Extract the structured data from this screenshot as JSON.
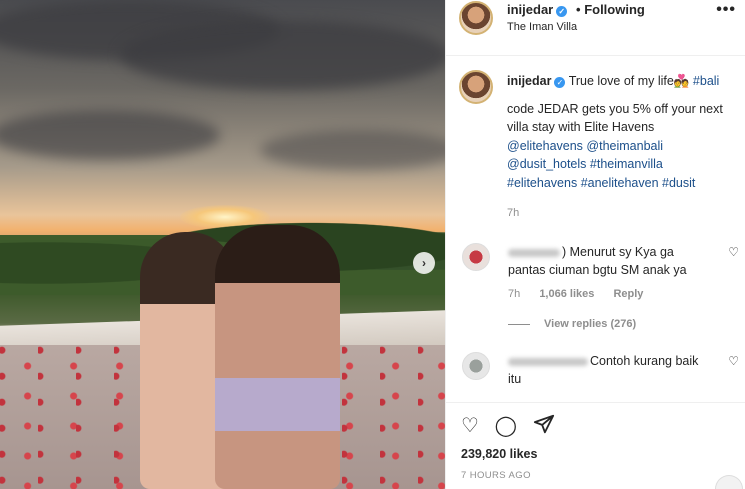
{
  "header": {
    "username": "inijedar",
    "follow_separator": "•",
    "follow_label": "Following",
    "location": "The Iman Villa",
    "more_label": "•••"
  },
  "caption": {
    "username": "inijedar",
    "text_line1": "True love of my life",
    "heart_emoji": "💑",
    "tag_bali": "#bali",
    "promo": "code JEDAR gets you 5% off your next villa stay with Elite Havens",
    "mention1": "@elitehavens",
    "mention2": "@theimanbali",
    "mention3": "@dusit_hotels",
    "tag1": "#theimanvilla",
    "tag2": "#elitehavens",
    "tag3": "#anelitehaven",
    "tag4": "#dusit",
    "time": "7h"
  },
  "comments": [
    {
      "text": ") Menurut sy Kya ga pantas ciuman bgtu SM anak ya",
      "time": "7h",
      "likes": "1,066 likes",
      "reply_label": "Reply",
      "view_replies": "View replies (276)"
    },
    {
      "text": "Contoh kurang baik itu"
    }
  ],
  "actions": {
    "like_count": "239,820 likes",
    "time_ago": "7 HOURS AGO"
  },
  "icons": {
    "next": "chevron-right-icon",
    "like": "heart-icon",
    "comment": "comment-icon",
    "share": "paper-plane-icon",
    "save": "bookmark-icon",
    "comment_like": "heart-icon"
  },
  "colors": {
    "link": "#1c4f8a",
    "verified": "#3897f0",
    "muted": "#8e8e8e"
  }
}
